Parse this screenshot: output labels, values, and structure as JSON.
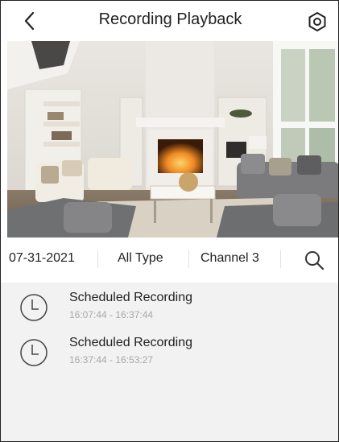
{
  "header": {
    "title": "Recording Playback",
    "back_icon": "chevron-left-icon",
    "settings_icon": "settings-gear-icon"
  },
  "video": {
    "scene": "living-room-fireplace"
  },
  "filters": {
    "date": "07-31-2021",
    "type": "All Type",
    "channel": "Channel  3",
    "search_icon": "search-icon"
  },
  "recordings": [
    {
      "title": "Scheduled Recording",
      "time": "16:07:44 - 16:37:44",
      "icon": "clock-icon"
    },
    {
      "title": "Scheduled Recording",
      "time": "16:37:44 - 16:53:27",
      "icon": "clock-icon"
    }
  ],
  "colors": {
    "list_background": "#f2f2f2",
    "time_text": "#a8a8a8",
    "primary_text": "#222222"
  }
}
